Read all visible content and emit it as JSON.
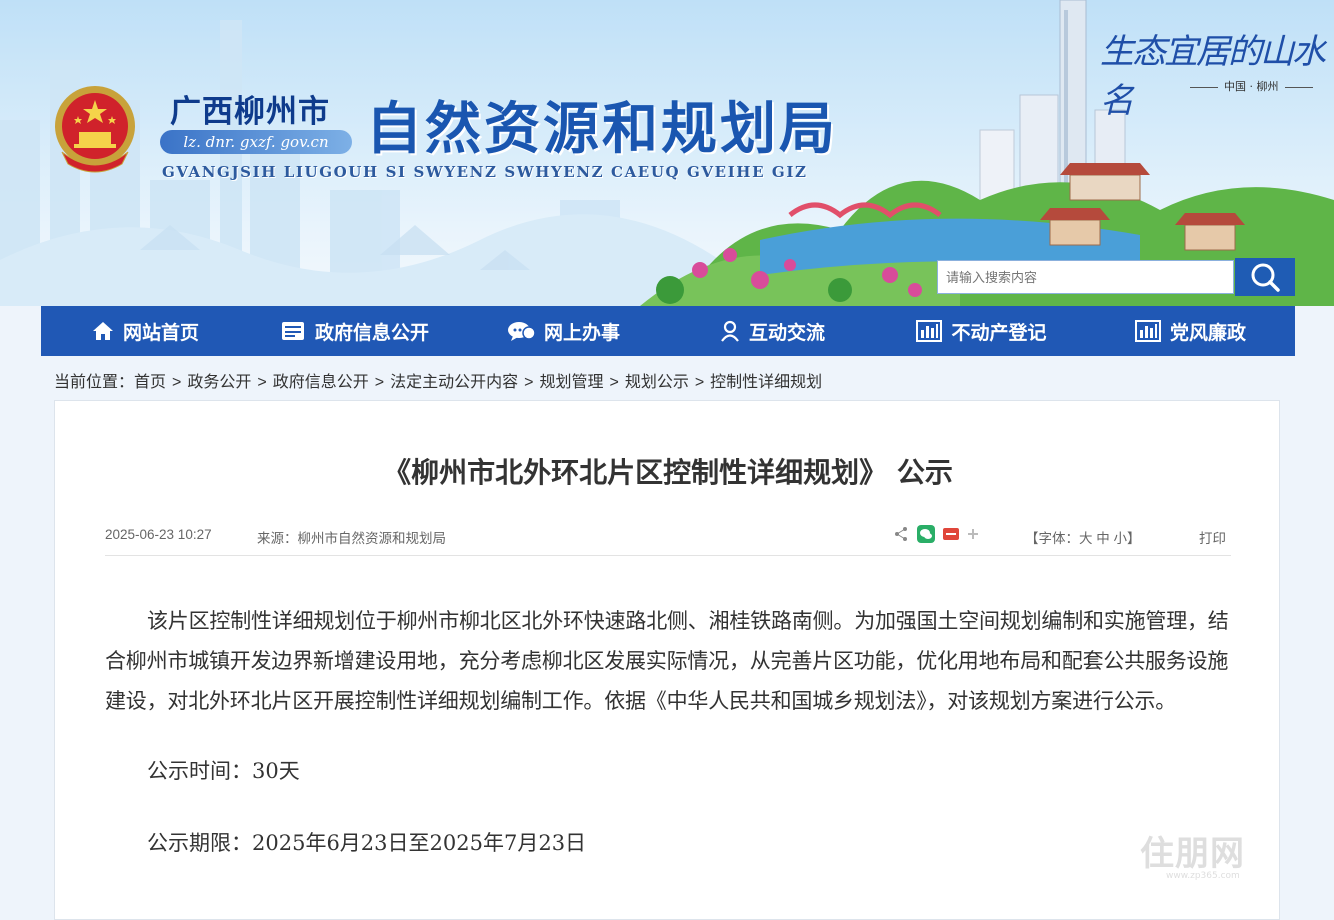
{
  "header": {
    "city": "广西柳州市",
    "url": "lz. dnr. gxzf. gov.cn",
    "bureau": "自然资源和规划局",
    "zhuang_name": "GVANGJSIH LIUGOUH SI SWYENZ SWHYENZ CAEUQ GVEIHE GIZ",
    "slogan": "生态宜居的山水名",
    "slogan_sub": "中国 · 柳州"
  },
  "search": {
    "placeholder": "请输入搜索内容",
    "icon": "search-icon"
  },
  "nav": {
    "items": [
      {
        "label": "网站首页",
        "icon": "home-icon"
      },
      {
        "label": "政府信息公开",
        "icon": "document-icon"
      },
      {
        "label": "网上办事",
        "icon": "chat-icon"
      },
      {
        "label": "互动交流",
        "icon": "user-icon"
      },
      {
        "label": "不动产登记",
        "icon": "bar-chart-icon"
      },
      {
        "label": "党风廉政",
        "icon": "bar-chart-icon"
      }
    ]
  },
  "breadcrumb": {
    "prefix": "当前位置：",
    "items": [
      "首页",
      "政务公开",
      "政府信息公开",
      "法定主动公开内容",
      "规划管理",
      "规划公示",
      "控制性详细规划"
    ],
    "separator": ">"
  },
  "article": {
    "title": "《柳州市北外环北片区控制性详细规划》 公示",
    "date": "2025-06-23 10:27",
    "source": "来源：柳州市自然资源和规划局",
    "font_size_label": "【字体：",
    "font_large": "大",
    "font_medium": "中",
    "font_small": "小",
    "font_size_end": "】",
    "print": "打印",
    "paragraph1": "该片区控制性详细规划位于柳州市柳北区北外环快速路北侧、湘桂铁路南侧。为加强国土空间规划编制和实施管理，结合柳州市城镇开发边界新增建设用地，充分考虑柳北区发展实际情况，从完善片区功能，优化用地布局和配套公共服务设施建设，对北外环北片区开展控制性详细规划编制工作。依据《中华人民共和国城乡规划法》，对该规划方案进行公示。",
    "paragraph2": "公示时间：30天",
    "paragraph3": "公示期限：2025年6月23日至2025年7月23日"
  },
  "watermark": {
    "text": "住朋网",
    "url": "www.zp365.com"
  },
  "colors": {
    "nav_bg": "#2058b5",
    "bureau_text": "#1a56b0",
    "search_button": "#1f5cb4"
  }
}
